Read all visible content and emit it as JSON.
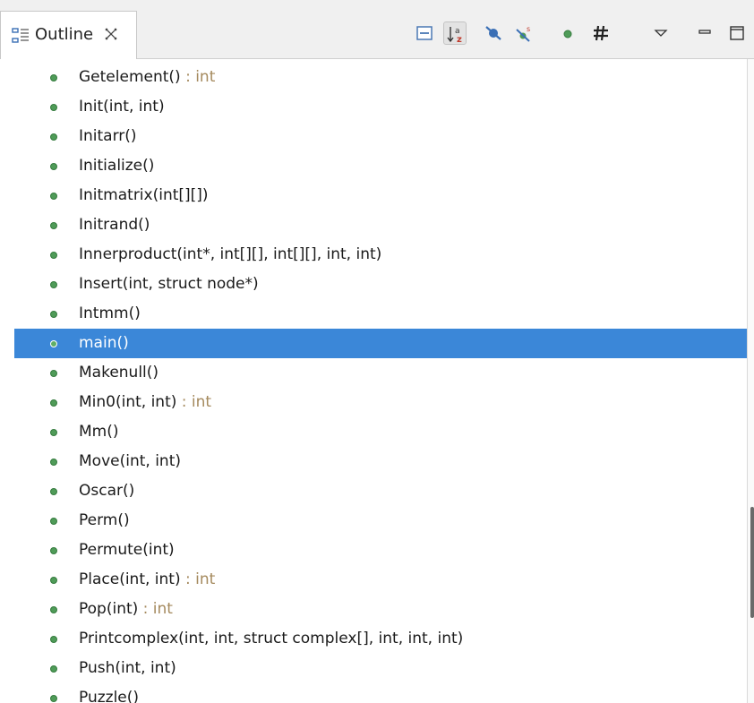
{
  "view": {
    "title": "Outline",
    "tab_icon": "outline-icon",
    "close_icon": "close-icon"
  },
  "toolbar": [
    {
      "name": "collapse-all-button",
      "icon": "collapse-all-icon",
      "pressed": false
    },
    {
      "name": "sort-button",
      "icon": "sort-alphabetical-icon",
      "pressed": true
    },
    {
      "name": "hide-fields-button",
      "icon": "hide-fields-icon",
      "pressed": false
    },
    {
      "name": "hide-static-members-button",
      "icon": "hide-static-icon",
      "pressed": false
    },
    {
      "name": "hide-non-public-button",
      "icon": "hide-non-public-icon",
      "pressed": false
    },
    {
      "name": "hide-macros-button",
      "icon": "hide-macros-icon",
      "pressed": false
    },
    {
      "name": "view-menu-button",
      "icon": "chevron-down-icon",
      "pressed": false
    },
    {
      "name": "minimize-button",
      "icon": "minimize-icon",
      "pressed": false
    },
    {
      "name": "maximize-button",
      "icon": "maximize-icon",
      "pressed": false
    }
  ],
  "colors": {
    "selection": "#3b87d8",
    "function_dot": "#4f9b58",
    "return_type": "#a58a5e"
  },
  "outline": {
    "items": [
      {
        "name": "Getelement()",
        "type": " : int",
        "selected": false
      },
      {
        "name": "Init(int, int)",
        "type": "",
        "selected": false
      },
      {
        "name": "Initarr()",
        "type": "",
        "selected": false
      },
      {
        "name": "Initialize()",
        "type": "",
        "selected": false
      },
      {
        "name": "Initmatrix(int[][])",
        "type": "",
        "selected": false
      },
      {
        "name": "Initrand()",
        "type": "",
        "selected": false
      },
      {
        "name": "Innerproduct(int*, int[][], int[][], int, int)",
        "type": "",
        "selected": false
      },
      {
        "name": "Insert(int, struct node*)",
        "type": "",
        "selected": false
      },
      {
        "name": "Intmm()",
        "type": "",
        "selected": false
      },
      {
        "name": "main()",
        "type": "",
        "selected": true
      },
      {
        "name": "Makenull()",
        "type": "",
        "selected": false
      },
      {
        "name": "Min0(int, int)",
        "type": " : int",
        "selected": false
      },
      {
        "name": "Mm()",
        "type": "",
        "selected": false
      },
      {
        "name": "Move(int, int)",
        "type": "",
        "selected": false
      },
      {
        "name": "Oscar()",
        "type": "",
        "selected": false
      },
      {
        "name": "Perm()",
        "type": "",
        "selected": false
      },
      {
        "name": "Permute(int)",
        "type": "",
        "selected": false
      },
      {
        "name": "Place(int, int)",
        "type": " : int",
        "selected": false
      },
      {
        "name": "Pop(int)",
        "type": " : int",
        "selected": false
      },
      {
        "name": "Printcomplex(int, int, struct complex[], int, int, int)",
        "type": "",
        "selected": false
      },
      {
        "name": "Push(int, int)",
        "type": "",
        "selected": false
      },
      {
        "name": "Puzzle()",
        "type": "",
        "selected": false
      }
    ]
  }
}
